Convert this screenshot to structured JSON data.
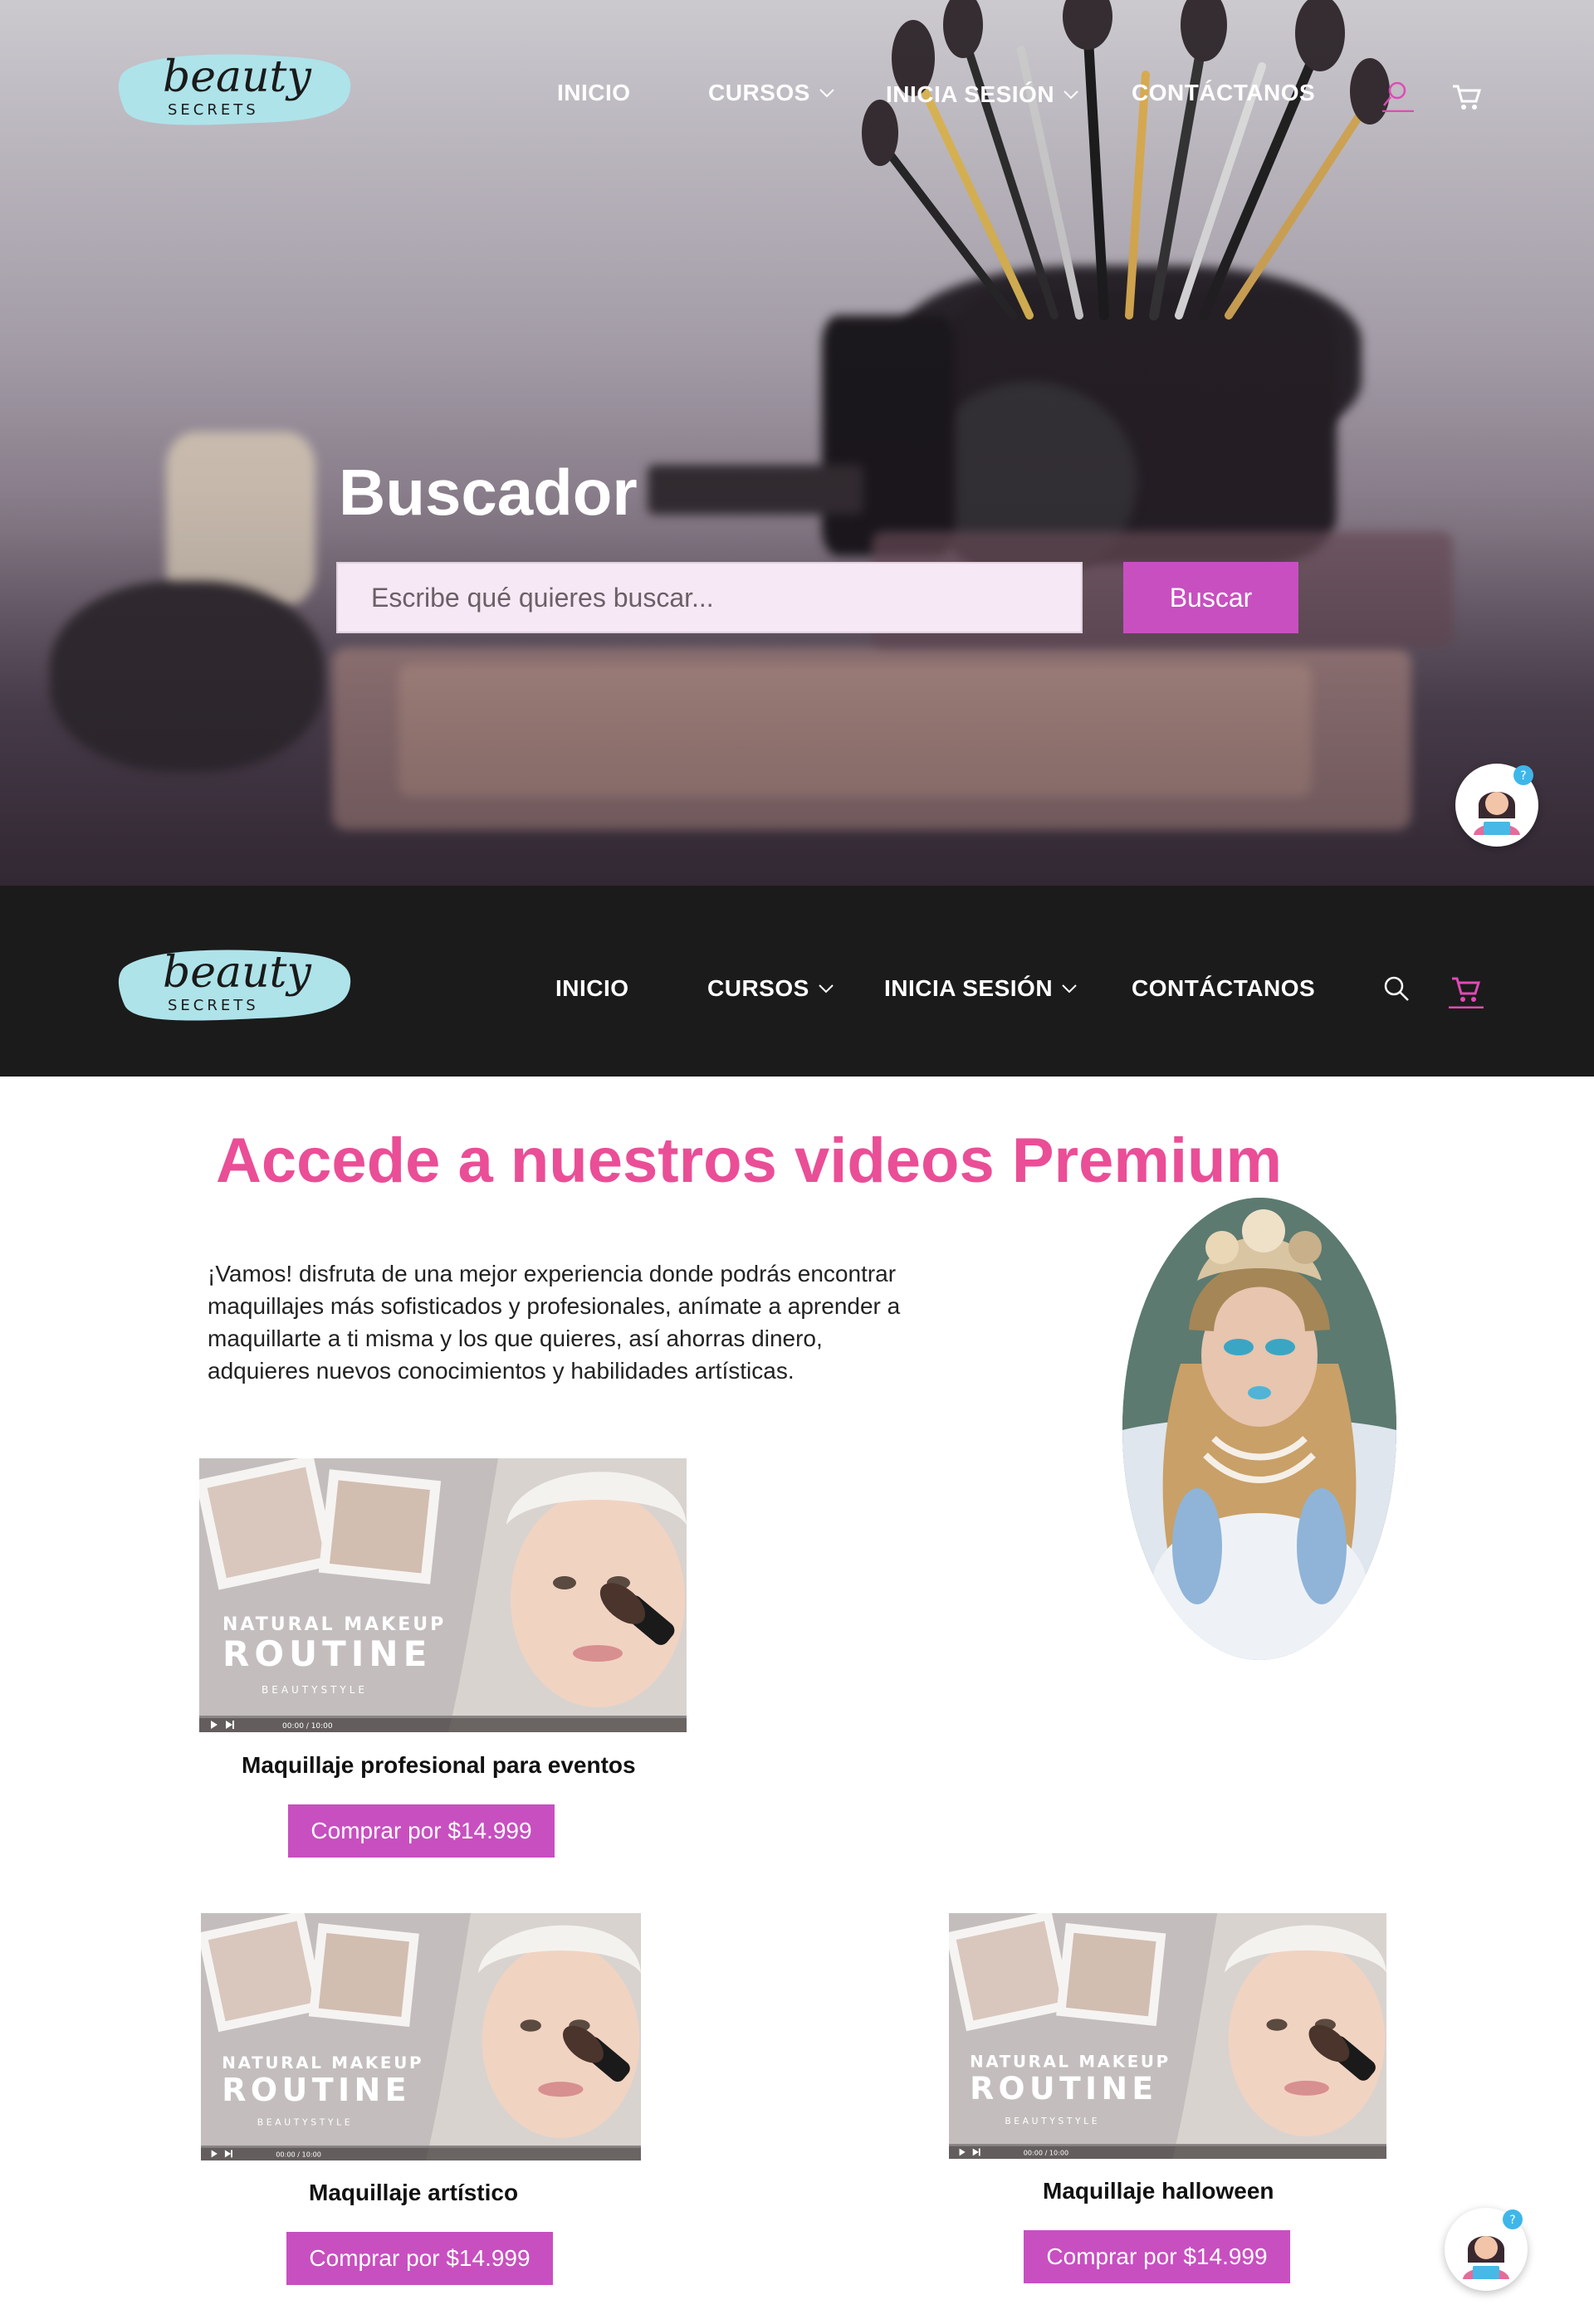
{
  "brand": {
    "logo_word": "beauty",
    "logo_sub": "SECRETS"
  },
  "nav": {
    "items": [
      {
        "label": "INICIO"
      },
      {
        "label": "CURSOS"
      },
      {
        "label": "INICIA SESIÓN"
      },
      {
        "label": "CONTÁCTANOS"
      }
    ],
    "icons": [
      "user-icon",
      "cart-icon",
      "search-icon"
    ]
  },
  "hero": {
    "title": "Buscador",
    "search": {
      "placeholder": "Escribe qué quieres buscar...",
      "value": ""
    },
    "button_label": "Buscar"
  },
  "premium": {
    "title": "Accede a nuestros videos Premium",
    "description": "¡Vamos! disfruta de una mejor experiencia donde podrás encontrar maquillajes más sofisticados y profesionales, anímate a aprender a maquillarte a ti misma y los que quieres, así ahorras dinero, adquieres nuevos conocimientos y habilidades artísticas."
  },
  "video_thumb": {
    "line1": "NATURAL MAKEUP",
    "line2": "ROUTINE",
    "line3": "BEAUTYSTYLE",
    "time": "00:00 / 10:00"
  },
  "courses": [
    {
      "title": "Maquillaje profesional para eventos",
      "button": "Comprar por $14.999"
    },
    {
      "title": "Maquillaje artístico",
      "button": "Comprar por $14.999"
    },
    {
      "title": "Maquillaje halloween",
      "button": "Comprar por $14.999"
    }
  ],
  "colors": {
    "accent": "#c84fc0",
    "title_pink": "#ea4e97",
    "dark_bar": "#1b1b1b",
    "logo_teal": "#aee3ea",
    "search_bg": "#f6e8f4"
  }
}
